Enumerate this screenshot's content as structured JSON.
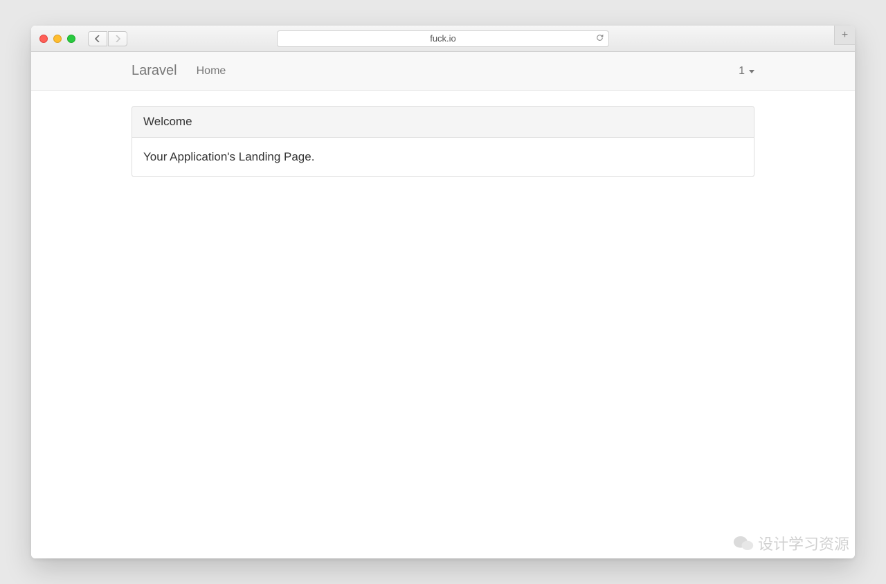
{
  "browser": {
    "url": "fuck.io"
  },
  "nav": {
    "brand": "Laravel",
    "home": "Home",
    "user_label": "1"
  },
  "panel": {
    "heading": "Welcome",
    "body": "Your Application's Landing Page."
  },
  "watermark": "设计学习资源"
}
